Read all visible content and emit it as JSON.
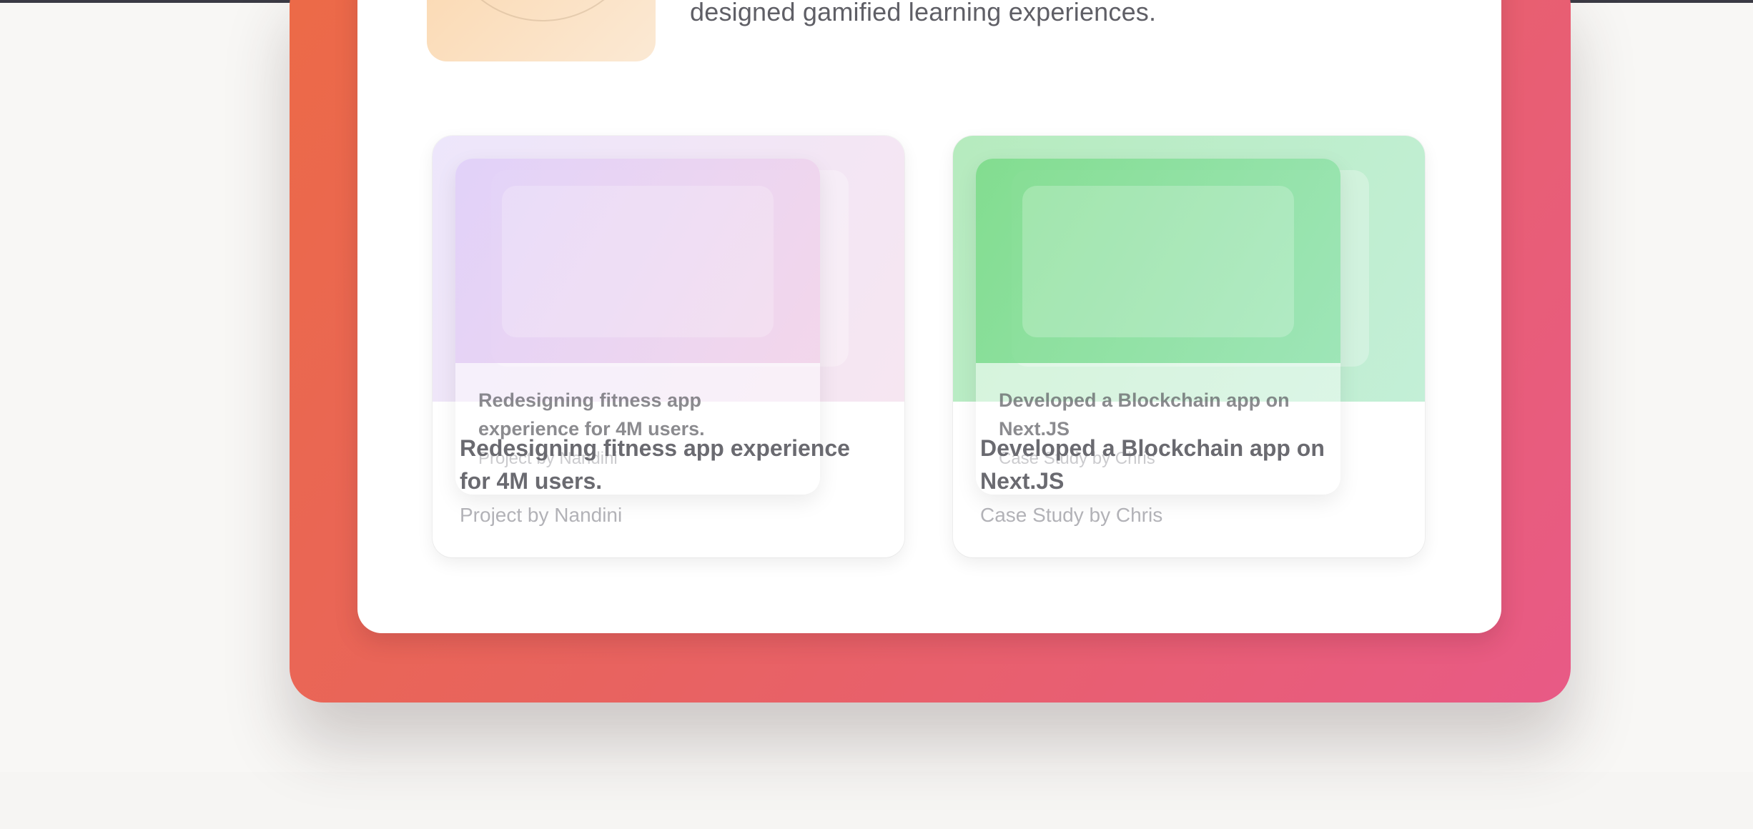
{
  "intro": {
    "text": "designed gamified learning experiences."
  },
  "cards": [
    {
      "title": "Redesigning fitness app experience for 4M users.",
      "author": "Project by Nandini",
      "accent": "#e9dcfa"
    },
    {
      "title": "Developed a Blockchain app on Next.JS",
      "author": "Case Study by Chris",
      "accent": "#8fe09c"
    }
  ],
  "colors": {
    "frame_start": "#ec6a47",
    "frame_end": "#e85a86",
    "avatar_bg": "#fbd9b2",
    "page_bg": "#f8f7f5"
  }
}
